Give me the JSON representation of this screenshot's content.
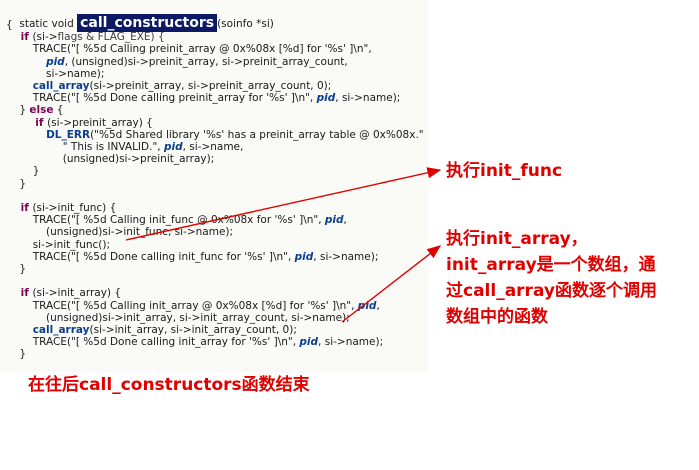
{
  "code": {
    "sig_prefix": "static void ",
    "func_name": "call_constructors",
    "sig_suffix": "(soinfo *si)",
    "lines": [
      {
        "segs": [
          {
            "t": "{",
            "c": ""
          }
        ]
      },
      {
        "segs": [
          {
            "t": "    if ",
            "c": "kw"
          },
          {
            "t": "(si->",
            "c": ""
          },
          {
            "t": "flags & FLAG_EXE) {",
            "c": "dim"
          }
        ]
      },
      {
        "segs": [
          {
            "t": "        TRACE(\"[ %5d Calling preinit_array @ 0x%08x [%d] for '%s' ]\\n\",",
            "c": ""
          }
        ]
      },
      {
        "segs": [
          {
            "t": "            ",
            "c": ""
          },
          {
            "t": "pid",
            "c": "emph"
          },
          {
            "t": ", (unsigned)si->preinit_array, si->preinit_array_count,",
            "c": ""
          }
        ]
      },
      {
        "segs": [
          {
            "t": "            si->name);",
            "c": ""
          }
        ]
      },
      {
        "segs": [
          {
            "t": "        ",
            "c": ""
          },
          {
            "t": "call_array",
            "c": "func"
          },
          {
            "t": "(si->preinit_array, si->preinit_array_count, 0);",
            "c": ""
          }
        ]
      },
      {
        "segs": [
          {
            "t": "        TRACE(\"[ %5d Done calling preinit_array for '%s' ]\\n\", ",
            "c": ""
          },
          {
            "t": "pid",
            "c": "emph"
          },
          {
            "t": ", si->name);",
            "c": ""
          }
        ]
      },
      {
        "segs": [
          {
            "t": "    } ",
            "c": ""
          },
          {
            "t": "else",
            "c": "kw"
          },
          {
            "t": " {",
            "c": ""
          }
        ]
      },
      {
        "segs": [
          {
            "t": "        if ",
            "c": "kw"
          },
          {
            "t": "(si->preinit_array) {",
            "c": ""
          }
        ]
      },
      {
        "segs": [
          {
            "t": "            ",
            "c": ""
          },
          {
            "t": "DL_ERR",
            "c": "func"
          },
          {
            "t": "(\"%5d Shared library '%s' has a preinit_array table @ 0x%08x.\"",
            "c": ""
          }
        ]
      },
      {
        "segs": [
          {
            "t": "                 \" This is INVALID.\", ",
            "c": ""
          },
          {
            "t": "pid",
            "c": "emph"
          },
          {
            "t": ", si->name,",
            "c": ""
          }
        ]
      },
      {
        "segs": [
          {
            "t": "                 (unsigned)si->preinit_array);",
            "c": ""
          }
        ]
      },
      {
        "segs": [
          {
            "t": "        }",
            "c": ""
          }
        ]
      },
      {
        "segs": [
          {
            "t": "    }",
            "c": ""
          }
        ]
      },
      {
        "segs": [
          {
            "t": "",
            "c": ""
          }
        ]
      },
      {
        "segs": [
          {
            "t": "    if ",
            "c": "kw"
          },
          {
            "t": "(si->init_func) {",
            "c": ""
          }
        ]
      },
      {
        "segs": [
          {
            "t": "        TRACE(\"[ %5d Calling init_func @ 0x%08x for '%s' ]\\n\", ",
            "c": ""
          },
          {
            "t": "pid",
            "c": "emph"
          },
          {
            "t": ",",
            "c": ""
          }
        ]
      },
      {
        "segs": [
          {
            "t": "            (unsigned)si->init_func, si->name);",
            "c": ""
          }
        ]
      },
      {
        "segs": [
          {
            "t": "        si->init_func();",
            "c": ""
          }
        ]
      },
      {
        "segs": [
          {
            "t": "        TRACE(\"[ %5d Done calling init_func for '%s' ]\\n\", ",
            "c": ""
          },
          {
            "t": "pid",
            "c": "emph"
          },
          {
            "t": ", si->name);",
            "c": ""
          }
        ]
      },
      {
        "segs": [
          {
            "t": "    }",
            "c": ""
          }
        ]
      },
      {
        "segs": [
          {
            "t": "",
            "c": ""
          }
        ]
      },
      {
        "segs": [
          {
            "t": "    if ",
            "c": "kw"
          },
          {
            "t": "(si->init_array) {",
            "c": ""
          }
        ]
      },
      {
        "segs": [
          {
            "t": "        TRACE(\"[ %5d Calling init_array @ 0x%08x [%d] for '%s' ]\\n\", ",
            "c": ""
          },
          {
            "t": "pid",
            "c": "emph"
          },
          {
            "t": ",",
            "c": ""
          }
        ]
      },
      {
        "segs": [
          {
            "t": "            (unsigned)si->init_array, si->init_array_count, si->name);",
            "c": ""
          }
        ]
      },
      {
        "segs": [
          {
            "t": "        ",
            "c": ""
          },
          {
            "t": "call_array",
            "c": "func"
          },
          {
            "t": "(si->init_array, si->init_array_count, 0);",
            "c": ""
          }
        ]
      },
      {
        "segs": [
          {
            "t": "        TRACE(\"[ %5d Done calling init_array for '%s' ]\\n\", ",
            "c": ""
          },
          {
            "t": "pid",
            "c": "emph"
          },
          {
            "t": ", si->name);",
            "c": ""
          }
        ]
      },
      {
        "segs": [
          {
            "t": "    }",
            "c": ""
          }
        ]
      }
    ]
  },
  "annotations": {
    "init_func": "执行init_func",
    "init_array_l1": "执行init_array，",
    "init_array_l2": "init_array是一个数组，通",
    "init_array_l3": "过call_array函数逐个调用",
    "init_array_l4": "数组中的函数",
    "end": "在往后call_constructors函数结束"
  },
  "colors": {
    "annotation": "#e00000",
    "highlight": "#0c1a66",
    "keyword": "#7f0055",
    "identifier": "#0b3d91"
  }
}
